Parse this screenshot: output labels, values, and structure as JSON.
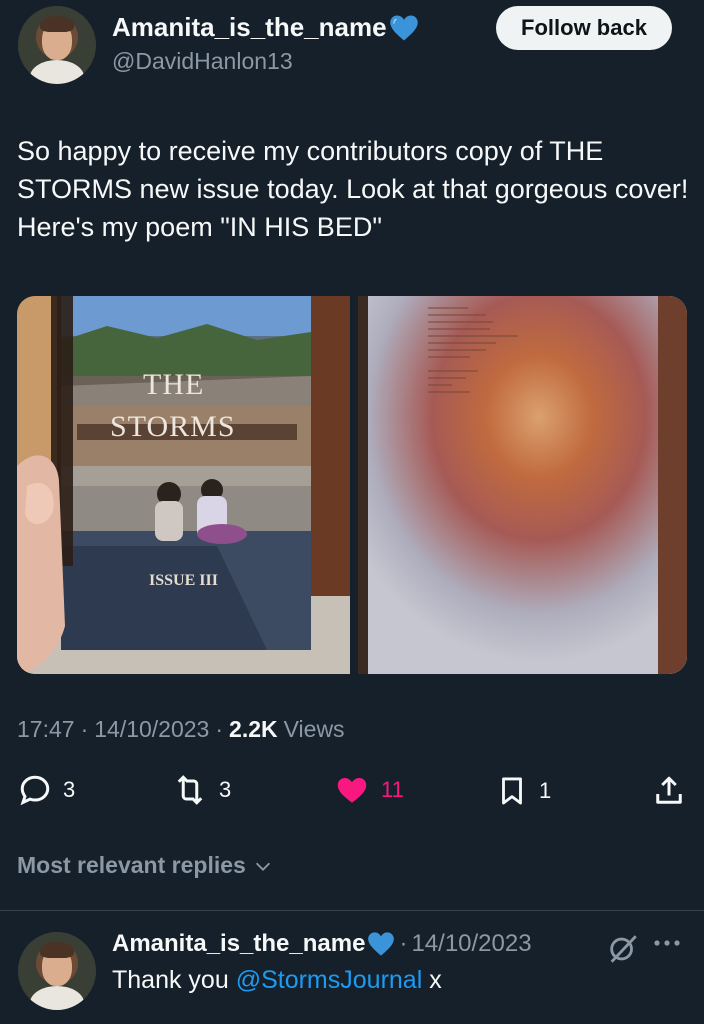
{
  "tweet": {
    "display_name": "Amanita_is_the_name",
    "handle": "@DavidHanlon13",
    "follow_label": "Follow back",
    "text": "So happy to receive my contributors copy of THE STORMS new issue today. Look at that gorgeous cover! Here's my poem \"IN HIS BED\"",
    "book_cover": {
      "title_line1": "THE",
      "title_line2": "STORMS",
      "issue": "ISSUE III"
    },
    "time": "17:47",
    "date": "14/10/2023",
    "views_count": "2.2K",
    "views_label": "Views",
    "replies_count": "3",
    "reposts_count": "3",
    "likes_count": "11",
    "bookmarks_count": "1"
  },
  "replies_filter": {
    "label": "Most relevant replies"
  },
  "reply": {
    "display_name": "Amanita_is_the_name",
    "date": "14/10/2023",
    "text_prefix": "Thank you",
    "mention": "@StormsJournal",
    "text_suffix": "x"
  },
  "colors": {
    "background": "#15202b",
    "text_primary": "#f7f9f9",
    "text_secondary": "#8b98a5",
    "like_pink": "#f91880",
    "link_blue": "#1d9bf0",
    "heart_emoji_blue": "#3b94d9"
  },
  "icons": {
    "verified_emoji": "blue-heart-icon",
    "reply": "reply-bubble-icon",
    "repost": "repost-icon",
    "like": "heart-icon",
    "bookmark": "bookmark-icon",
    "share": "share-icon",
    "grok": "grok-icon",
    "more": "more-icon"
  }
}
